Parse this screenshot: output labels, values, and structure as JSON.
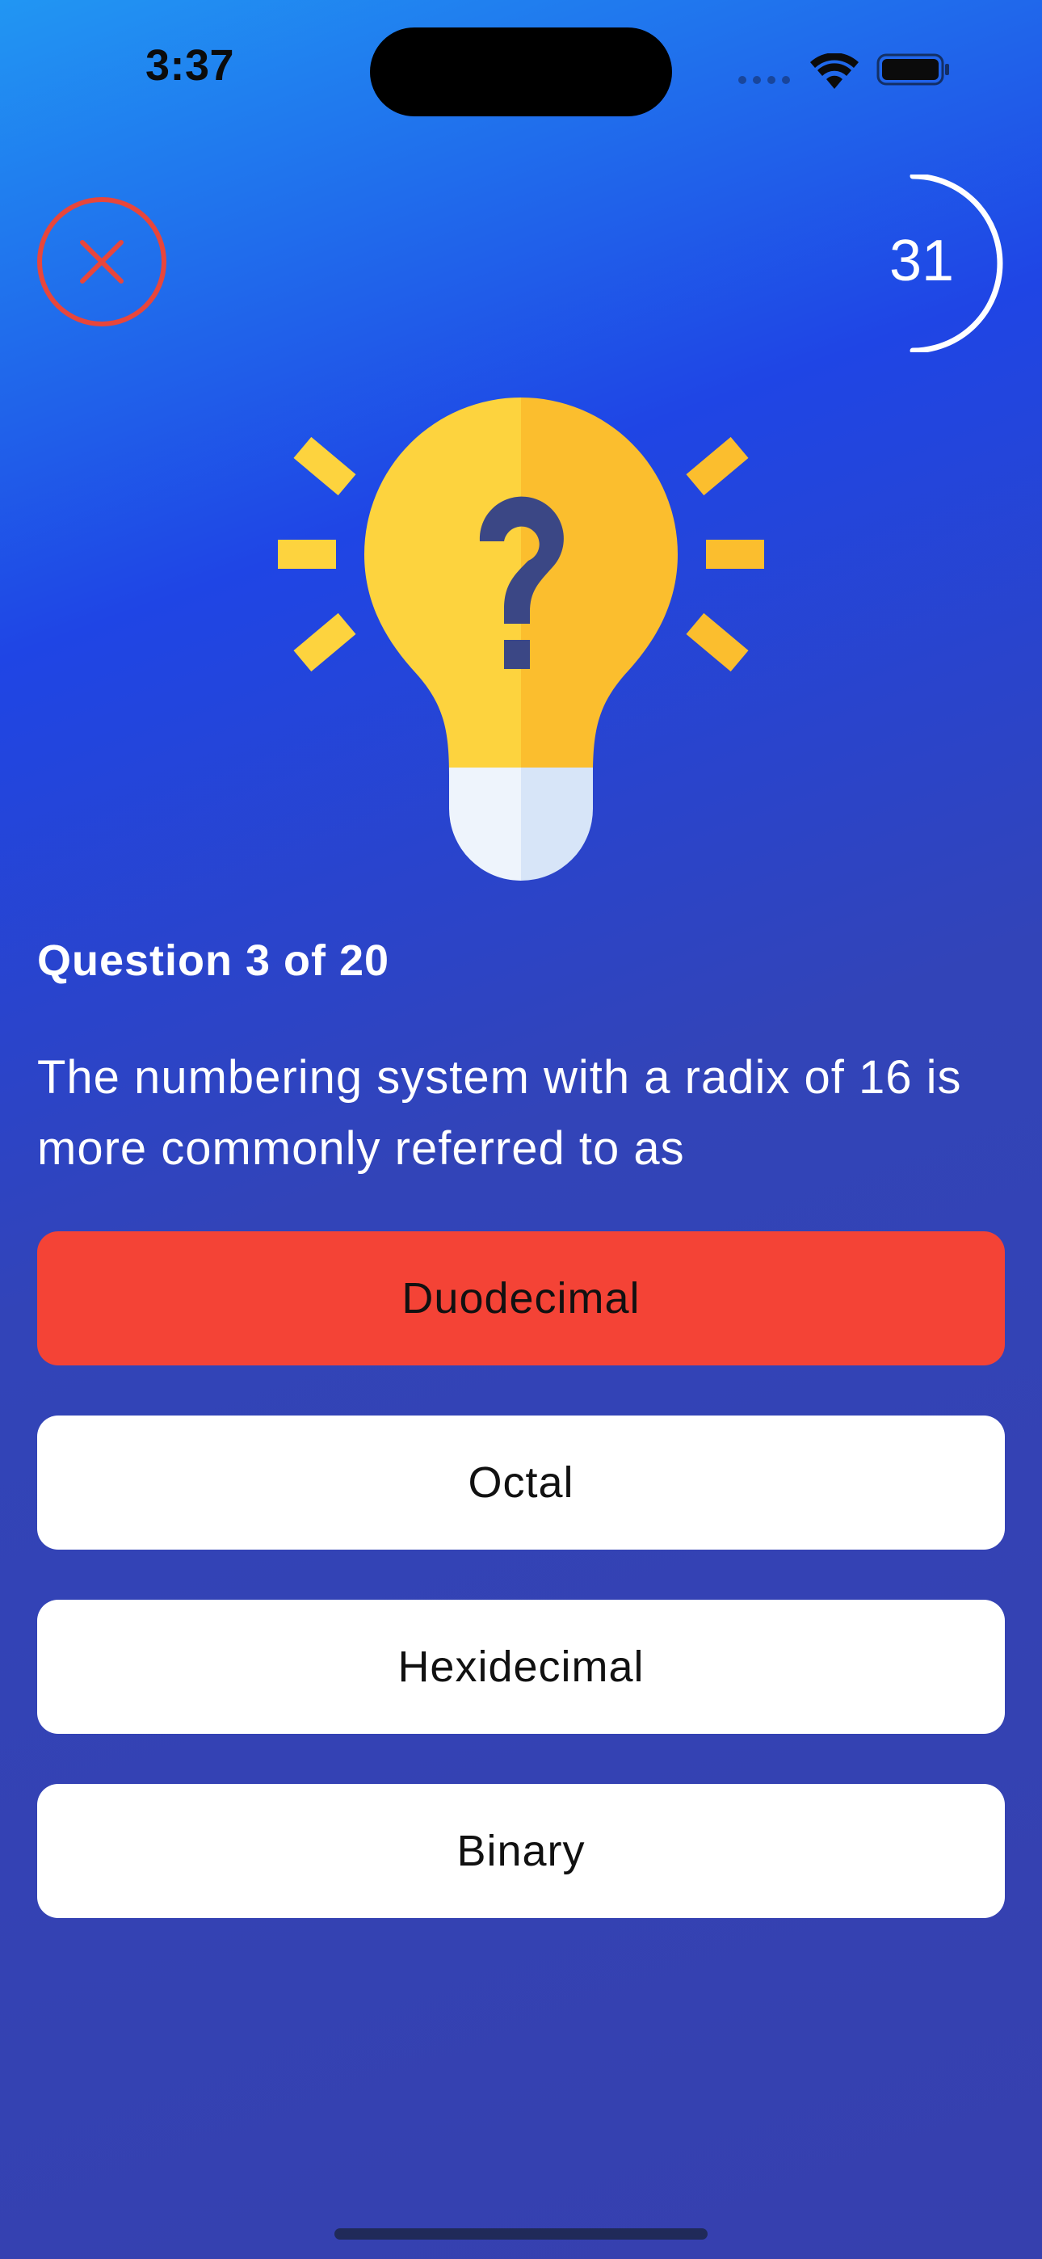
{
  "status_bar": {
    "time": "3:37",
    "icons": [
      "cellular-signal-icon",
      "wifi-icon",
      "battery-icon"
    ]
  },
  "header": {
    "close_icon": "close-icon",
    "timer_value": "31"
  },
  "illustration": {
    "icon": "lightbulb-question-icon"
  },
  "question": {
    "counter": "Question 3 of 20",
    "text": "The numbering system with a radix of 16 is more commonly referred to as"
  },
  "answers": [
    {
      "label": "Duodecimal",
      "state": "wrong"
    },
    {
      "label": "Octal",
      "state": "default"
    },
    {
      "label": "Hexidecimal",
      "state": "default"
    },
    {
      "label": "Binary",
      "state": "default"
    }
  ],
  "colors": {
    "wrong": "#F44336",
    "close_ring": "#E8463B",
    "bulb_yellow": "#FDD33E",
    "bulb_yellow_dark": "#FBBE2E",
    "question_mark": "#3B4785",
    "answer_default": "#FFFFFF"
  }
}
